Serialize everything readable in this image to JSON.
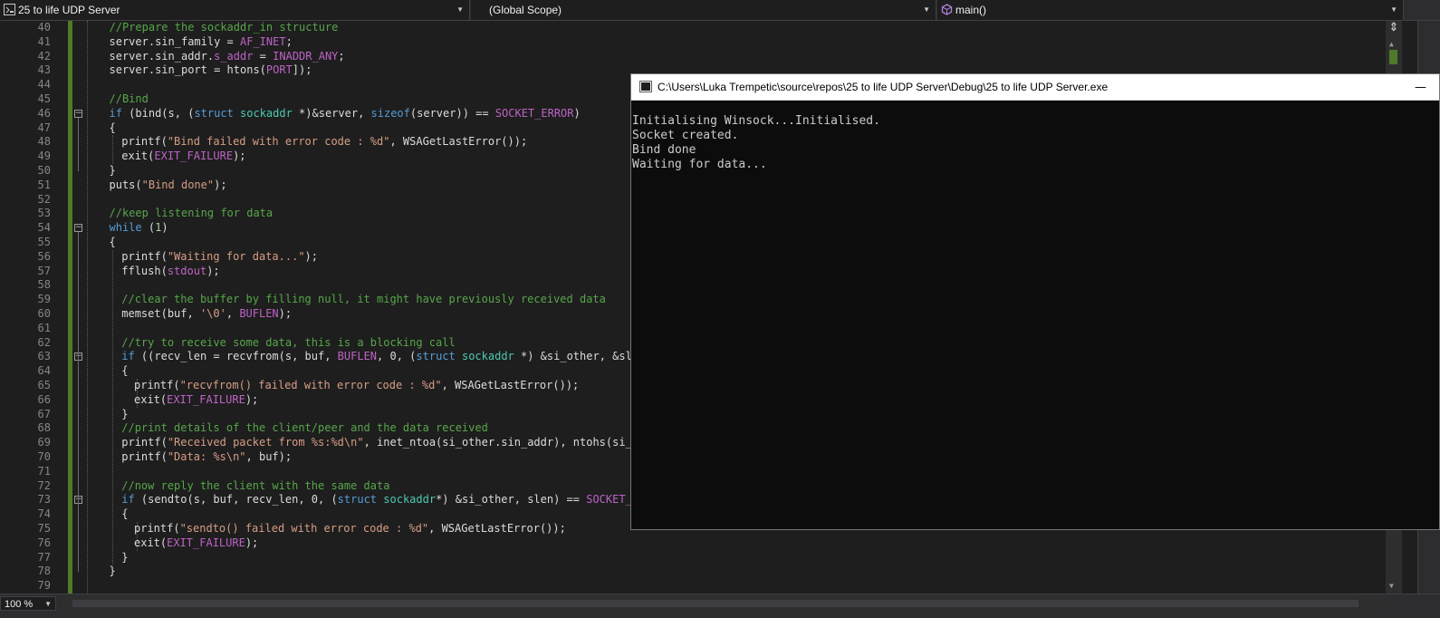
{
  "navbar": {
    "project": "25 to life UDP Server",
    "scope": "(Global Scope)",
    "member": "main()"
  },
  "editor": {
    "lines": [
      {
        "n": "40",
        "indent": 2,
        "segs": [
          [
            "cm",
            "//Prepare the sockaddr_in structure"
          ]
        ]
      },
      {
        "n": "41",
        "indent": 2,
        "segs": [
          [
            "pl",
            "server.sin_family = "
          ],
          [
            "mc",
            "AF_INET"
          ],
          [
            "pl",
            ";"
          ]
        ]
      },
      {
        "n": "42",
        "indent": 2,
        "segs": [
          [
            "pl",
            "server.sin_addr."
          ],
          [
            "mc",
            "s_addr"
          ],
          [
            "pl",
            " = "
          ],
          [
            "mc",
            "INADDR_ANY"
          ],
          [
            "pl",
            ";"
          ]
        ]
      },
      {
        "n": "43",
        "indent": 2,
        "segs": [
          [
            "pl",
            "server.sin_port = htons("
          ],
          [
            "mc",
            "PORT"
          ],
          [
            "pl",
            "]);"
          ]
        ]
      },
      {
        "n": "44",
        "indent": 0,
        "segs": []
      },
      {
        "n": "45",
        "indent": 2,
        "segs": [
          [
            "cm",
            "//Bind"
          ]
        ]
      },
      {
        "n": "46",
        "indent": 2,
        "segs": [
          [
            "kw",
            "if"
          ],
          [
            "pl",
            " (bind(s, ("
          ],
          [
            "kw",
            "struct"
          ],
          [
            "pl",
            " "
          ],
          [
            "ty",
            "sockaddr"
          ],
          [
            "pl",
            " *)&server, "
          ],
          [
            "kw",
            "sizeof"
          ],
          [
            "pl",
            "(server)) == "
          ],
          [
            "mc",
            "SOCKET_ERROR"
          ],
          [
            "pl",
            ")"
          ]
        ]
      },
      {
        "n": "47",
        "indent": 2,
        "segs": [
          [
            "pl",
            "{"
          ]
        ]
      },
      {
        "n": "48",
        "indent": 3,
        "segs": [
          [
            "pl",
            "printf("
          ],
          [
            "st",
            "\"Bind failed with error code : %d\""
          ],
          [
            "pl",
            ", WSAGetLastError());"
          ]
        ]
      },
      {
        "n": "49",
        "indent": 3,
        "segs": [
          [
            "pl",
            "exit("
          ],
          [
            "mc",
            "EXIT_FAILURE"
          ],
          [
            "pl",
            ");"
          ]
        ]
      },
      {
        "n": "50",
        "indent": 2,
        "segs": [
          [
            "pl",
            "}"
          ]
        ]
      },
      {
        "n": "51",
        "indent": 2,
        "segs": [
          [
            "pl",
            "puts("
          ],
          [
            "st",
            "\"Bind done\""
          ],
          [
            "pl",
            ");"
          ]
        ]
      },
      {
        "n": "52",
        "indent": 0,
        "segs": []
      },
      {
        "n": "53",
        "indent": 2,
        "segs": [
          [
            "cm",
            "//keep listening for data"
          ]
        ]
      },
      {
        "n": "54",
        "indent": 2,
        "segs": [
          [
            "kw",
            "while"
          ],
          [
            "pl",
            " ("
          ],
          [
            "nm",
            "1"
          ],
          [
            "pl",
            ")"
          ]
        ]
      },
      {
        "n": "55",
        "indent": 2,
        "segs": [
          [
            "pl",
            "{"
          ]
        ]
      },
      {
        "n": "56",
        "indent": 3,
        "segs": [
          [
            "pl",
            "printf("
          ],
          [
            "st",
            "\"Waiting for data...\""
          ],
          [
            "pl",
            ");"
          ]
        ]
      },
      {
        "n": "57",
        "indent": 3,
        "segs": [
          [
            "pl",
            "fflush("
          ],
          [
            "mc",
            "stdout"
          ],
          [
            "pl",
            ");"
          ]
        ]
      },
      {
        "n": "58",
        "indent": 0,
        "segs": []
      },
      {
        "n": "59",
        "indent": 3,
        "segs": [
          [
            "cm",
            "//clear the buffer by filling null, it might have previously received data"
          ]
        ]
      },
      {
        "n": "60",
        "indent": 3,
        "segs": [
          [
            "pl",
            "memset(buf, "
          ],
          [
            "st",
            "'\\0'"
          ],
          [
            "pl",
            ", "
          ],
          [
            "mc",
            "BUFLEN"
          ],
          [
            "pl",
            ");"
          ]
        ]
      },
      {
        "n": "61",
        "indent": 0,
        "segs": []
      },
      {
        "n": "62",
        "indent": 3,
        "segs": [
          [
            "cm",
            "//try to receive some data, this is a blocking call"
          ]
        ]
      },
      {
        "n": "63",
        "indent": 3,
        "segs": [
          [
            "kw",
            "if"
          ],
          [
            "pl",
            " ((recv_len = recvfrom(s, buf, "
          ],
          [
            "mc",
            "BUFLEN"
          ],
          [
            "pl",
            ", 0, ("
          ],
          [
            "kw",
            "struct"
          ],
          [
            "pl",
            " "
          ],
          [
            "ty",
            "sockaddr"
          ],
          [
            "pl",
            " *) &si_other, &slen"
          ]
        ]
      },
      {
        "n": "64",
        "indent": 3,
        "segs": [
          [
            "pl",
            "{"
          ]
        ]
      },
      {
        "n": "65",
        "indent": 4,
        "segs": [
          [
            "pl",
            "printf("
          ],
          [
            "st",
            "\"recvfrom() failed with error code : %d\""
          ],
          [
            "pl",
            ", WSAGetLastError());"
          ]
        ]
      },
      {
        "n": "66",
        "indent": 4,
        "segs": [
          [
            "pl",
            "exit("
          ],
          [
            "mc",
            "EXIT_FAILURE"
          ],
          [
            "pl",
            ");"
          ]
        ]
      },
      {
        "n": "67",
        "indent": 3,
        "segs": [
          [
            "pl",
            "}"
          ]
        ]
      },
      {
        "n": "68",
        "indent": 3,
        "segs": [
          [
            "cm",
            "//print details of the client/peer and the data received"
          ]
        ]
      },
      {
        "n": "69",
        "indent": 3,
        "segs": [
          [
            "pl",
            "printf("
          ],
          [
            "st",
            "\"Received packet from %s:%d\\n\""
          ],
          [
            "pl",
            ", inet_ntoa(si_other.sin_addr), ntohs(si_ot"
          ]
        ]
      },
      {
        "n": "70",
        "indent": 3,
        "segs": [
          [
            "pl",
            "printf("
          ],
          [
            "st",
            "\"Data: %s\\n\""
          ],
          [
            "pl",
            ", buf);"
          ]
        ]
      },
      {
        "n": "71",
        "indent": 0,
        "segs": []
      },
      {
        "n": "72",
        "indent": 3,
        "segs": [
          [
            "cm",
            "//now reply the client with the same data"
          ]
        ]
      },
      {
        "n": "73",
        "indent": 3,
        "segs": [
          [
            "kw",
            "if"
          ],
          [
            "pl",
            " (sendto(s, buf, recv_len, 0, ("
          ],
          [
            "kw",
            "struct"
          ],
          [
            "pl",
            " "
          ],
          [
            "ty",
            "sockaddr"
          ],
          [
            "pl",
            "*) &si_other, slen) == "
          ],
          [
            "mc",
            "SOCKET_EF"
          ]
        ]
      },
      {
        "n": "74",
        "indent": 3,
        "segs": [
          [
            "pl",
            "{"
          ]
        ]
      },
      {
        "n": "75",
        "indent": 4,
        "segs": [
          [
            "pl",
            "printf("
          ],
          [
            "st",
            "\"sendto() failed with error code : %d\""
          ],
          [
            "pl",
            ", WSAGetLastError());"
          ]
        ]
      },
      {
        "n": "76",
        "indent": 4,
        "segs": [
          [
            "pl",
            "exit("
          ],
          [
            "mc",
            "EXIT_FAILURE"
          ],
          [
            "pl",
            ");"
          ]
        ]
      },
      {
        "n": "77",
        "indent": 3,
        "segs": [
          [
            "pl",
            "}"
          ]
        ]
      },
      {
        "n": "78",
        "indent": 2,
        "segs": [
          [
            "pl",
            "}"
          ]
        ]
      },
      {
        "n": "79",
        "indent": 0,
        "segs": []
      }
    ]
  },
  "console": {
    "title": "C:\\Users\\Luka Trempetic\\source\\repos\\25 to life UDP Server\\Debug\\25 to life UDP Server.exe",
    "minimize": "—",
    "lines": [
      "Initialising Winsock...Initialised.",
      "Socket created.",
      "Bind done",
      "Waiting for data..."
    ]
  },
  "statusbar": {
    "zoom": "100 %"
  },
  "colors": {
    "editor_bg": "#1e1e1e",
    "comment": "#57a64a",
    "keyword": "#569cd6",
    "type": "#4ec9b0",
    "macro": "#bd63c5",
    "string": "#d69d85",
    "changes": "#4f7a28"
  }
}
